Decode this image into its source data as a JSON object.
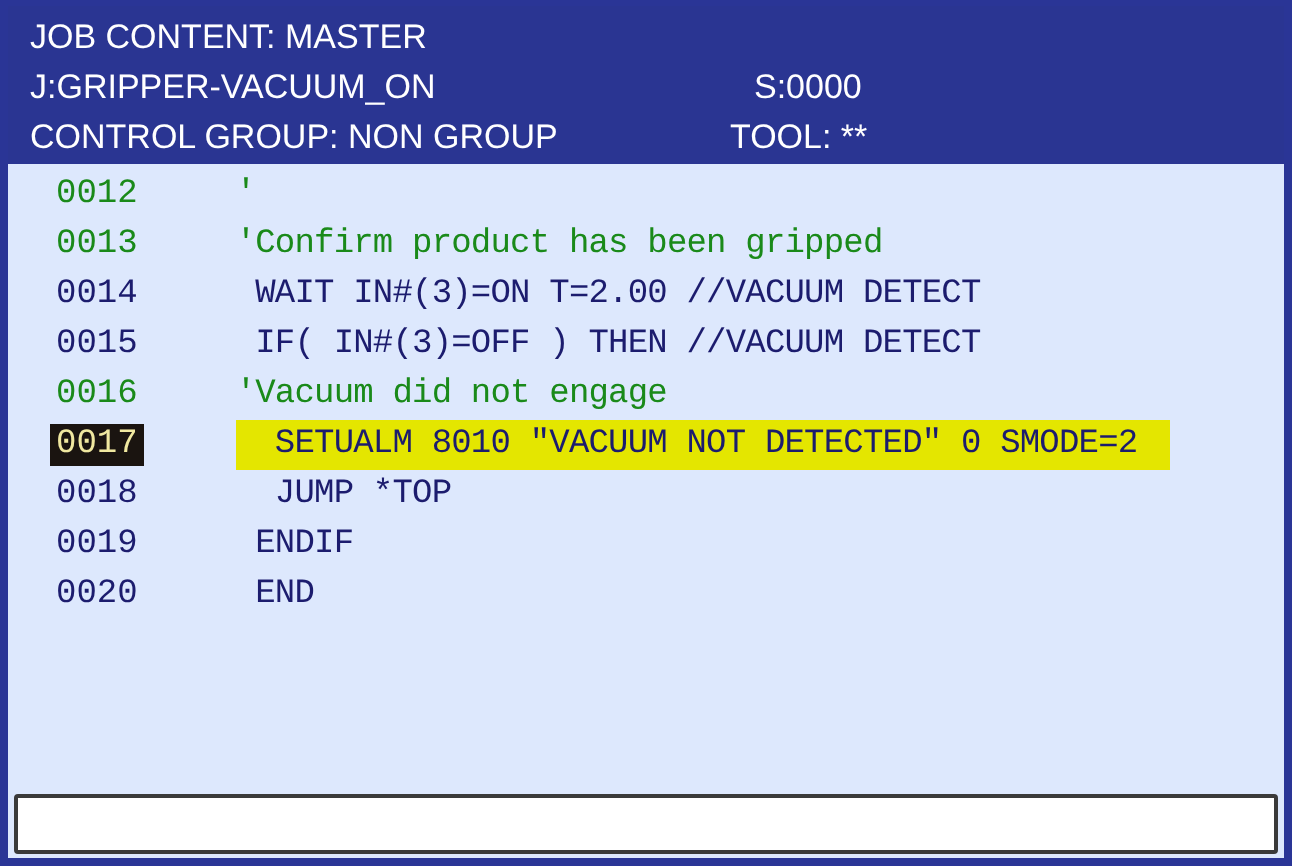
{
  "header": {
    "title": "JOB CONTENT: MASTER",
    "job": "J:GRIPPER-VACUUM_ON",
    "step": "S:0000",
    "control_group": "CONTROL GROUP: NON GROUP",
    "tool": "TOOL: **"
  },
  "lines": [
    {
      "number": "0012",
      "text": "'",
      "kind": "comment",
      "selected": false,
      "highlighted": false
    },
    {
      "number": "0013",
      "text": "'Confirm product has been gripped",
      "kind": "comment",
      "selected": false,
      "highlighted": false
    },
    {
      "number": "0014",
      "text": " WAIT IN#(3)=ON T=2.00 //VACUUM DETECT",
      "kind": "instruction",
      "selected": false,
      "highlighted": false
    },
    {
      "number": "0015",
      "text": " IF( IN#(3)=OFF ) THEN //VACUUM DETECT",
      "kind": "instruction",
      "selected": false,
      "highlighted": false
    },
    {
      "number": "0016",
      "text": "'Vacuum did not engage",
      "kind": "comment",
      "selected": false,
      "highlighted": false
    },
    {
      "number": "0017",
      "text": "  SETUALM 8010 \"VACUUM NOT DETECTED\" 0 SMODE=2",
      "kind": "instruction",
      "selected": true,
      "highlighted": true
    },
    {
      "number": "0018",
      "text": "  JUMP *TOP",
      "kind": "instruction",
      "selected": false,
      "highlighted": false
    },
    {
      "number": "0019",
      "text": " ENDIF",
      "kind": "instruction",
      "selected": false,
      "highlighted": false
    },
    {
      "number": "0020",
      "text": " END",
      "kind": "instruction",
      "selected": false,
      "highlighted": false
    }
  ]
}
